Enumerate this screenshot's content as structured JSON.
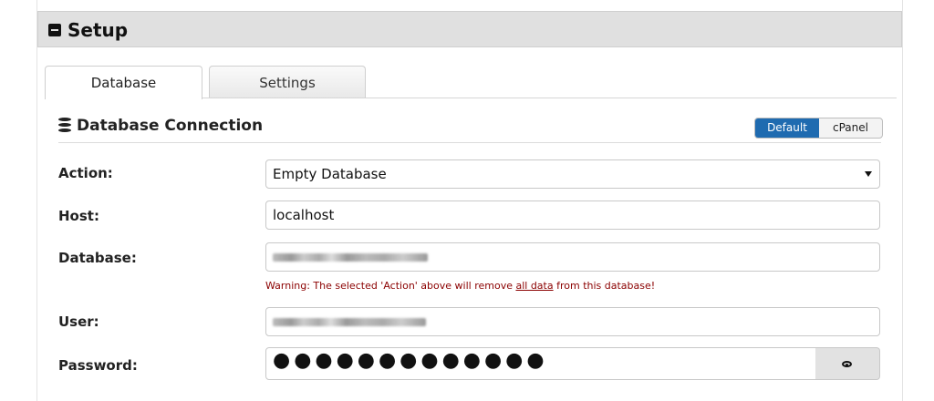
{
  "panel": {
    "title": "Setup"
  },
  "tabs": [
    {
      "label": "Database",
      "active": true
    },
    {
      "label": "Settings",
      "active": false
    }
  ],
  "section": {
    "title": "Database Connection"
  },
  "mode_toggle": {
    "options": [
      "Default",
      "cPanel"
    ],
    "selected": "Default"
  },
  "form": {
    "action": {
      "label": "Action:",
      "value": "Empty Database"
    },
    "host": {
      "label": "Host:",
      "value": "localhost"
    },
    "database": {
      "label": "Database:",
      "value": ""
    },
    "warning": {
      "prefix": "Warning: The selected 'Action' above will remove ",
      "link": "all data",
      "suffix": " from this database!"
    },
    "user": {
      "label": "User:",
      "value": ""
    },
    "password": {
      "label": "Password:",
      "masked_value": "●●●●●●●●●●●●●"
    }
  },
  "icons": {
    "collapse": "minus-square-icon",
    "database": "database-icon",
    "show_password": "eye-icon"
  },
  "colors": {
    "toggle_active": "#1f6bb0",
    "warning": "#8b0000",
    "header_bg": "#e0e0e0"
  }
}
